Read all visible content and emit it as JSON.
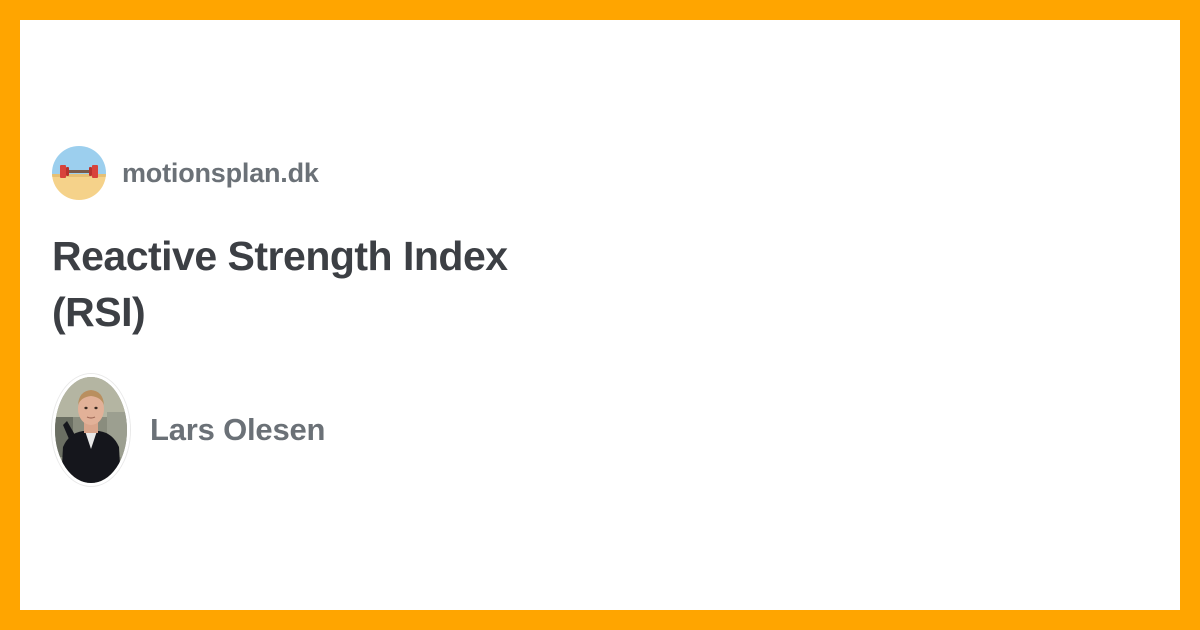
{
  "site": {
    "name": "motionsplan.dk",
    "logo_icon": "dumbbell-beach-icon"
  },
  "article": {
    "title_line1": "Reactive Strength Index",
    "title_line2": "(RSI)"
  },
  "author": {
    "name": "Lars Olesen",
    "avatar_icon": "author-avatar"
  },
  "colors": {
    "frame": "#ffa500",
    "background": "#ffffff",
    "title": "#3c3f44",
    "meta_text": "#6b7177"
  }
}
